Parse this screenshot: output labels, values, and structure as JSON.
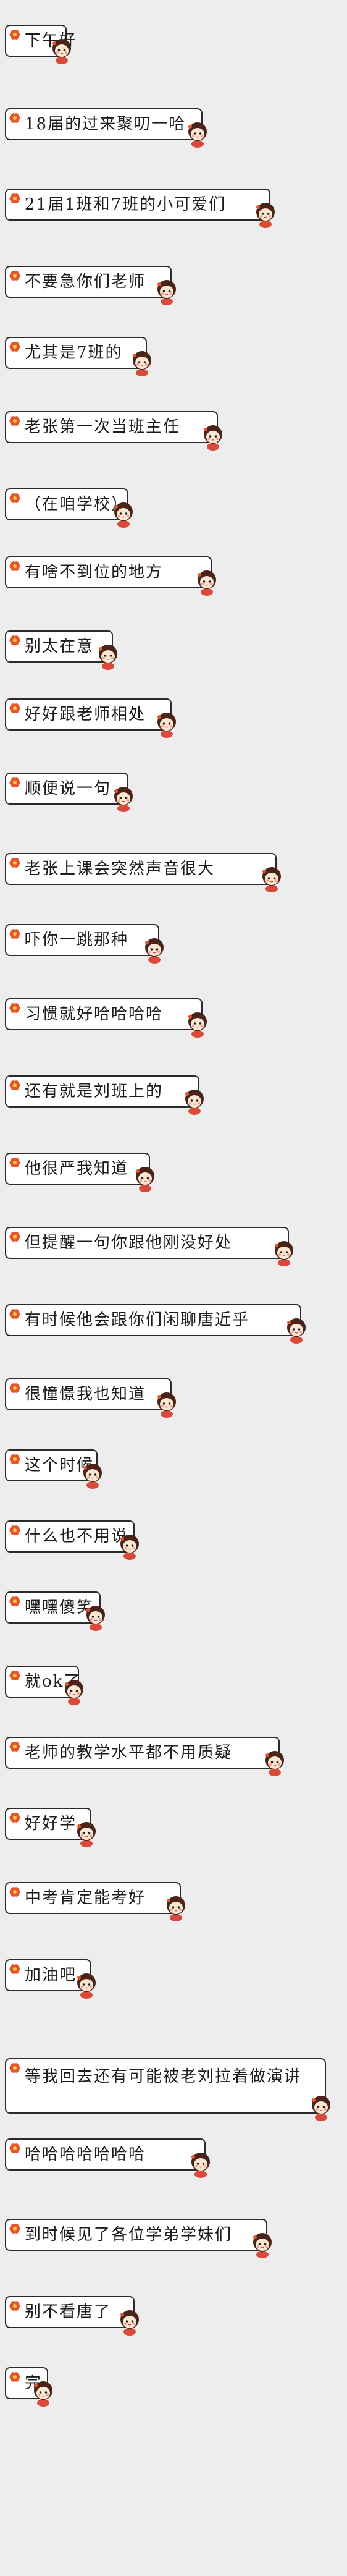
{
  "colors": {
    "background": "#ededed",
    "bubble_fill": "#ffffff",
    "bubble_border": "#2b2b2b",
    "text": "#1c1c1c",
    "flower": "#e8542b",
    "doll_hair": "#4a2418",
    "doll_face": "#fbe6d2",
    "doll_cheek": "#f08a8a"
  },
  "icons": {
    "flower": "orange-flower-icon",
    "doll": "cartoon-girl-sticker-icon"
  },
  "messages": [
    {
      "text": "下午好"
    },
    {
      "text": "18届的过来聚叨一哈"
    },
    {
      "text": "21届1班和7班的小可爱们"
    },
    {
      "text": "不要急你们老师"
    },
    {
      "text": "尤其是7班的"
    },
    {
      "text": "老张第一次当班主任"
    },
    {
      "text": "（在咱学校）"
    },
    {
      "text": "有啥不到位的地方"
    },
    {
      "text": "别太在意"
    },
    {
      "text": "好好跟老师相处"
    },
    {
      "text": "顺便说一句"
    },
    {
      "text": "老张上课会突然声音很大"
    },
    {
      "text": "吓你一跳那种"
    },
    {
      "text": "习惯就好哈哈哈哈"
    },
    {
      "text": "还有就是刘班上的"
    },
    {
      "text": "他很严我知道"
    },
    {
      "text": "但提醒一句你跟他刚没好处"
    },
    {
      "text": "有时候他会跟你们闲聊唐近乎"
    },
    {
      "text": "很憧憬我也知道"
    },
    {
      "text": "这个时候"
    },
    {
      "text": "什么也不用说"
    },
    {
      "text": "嘿嘿傻笑"
    },
    {
      "text": "就ok了"
    },
    {
      "text": "老师的教学水平都不用质疑"
    },
    {
      "text": "好好学"
    },
    {
      "text": "中考肯定能考好"
    },
    {
      "text": "加油吧"
    },
    {
      "text": "等我回去还有可能被老刘拉着做演讲"
    },
    {
      "text": "哈哈哈哈哈哈哈"
    },
    {
      "text": "到时候见了各位学弟学妹们"
    },
    {
      "text": "别不看唐了"
    },
    {
      "text": "完"
    }
  ]
}
